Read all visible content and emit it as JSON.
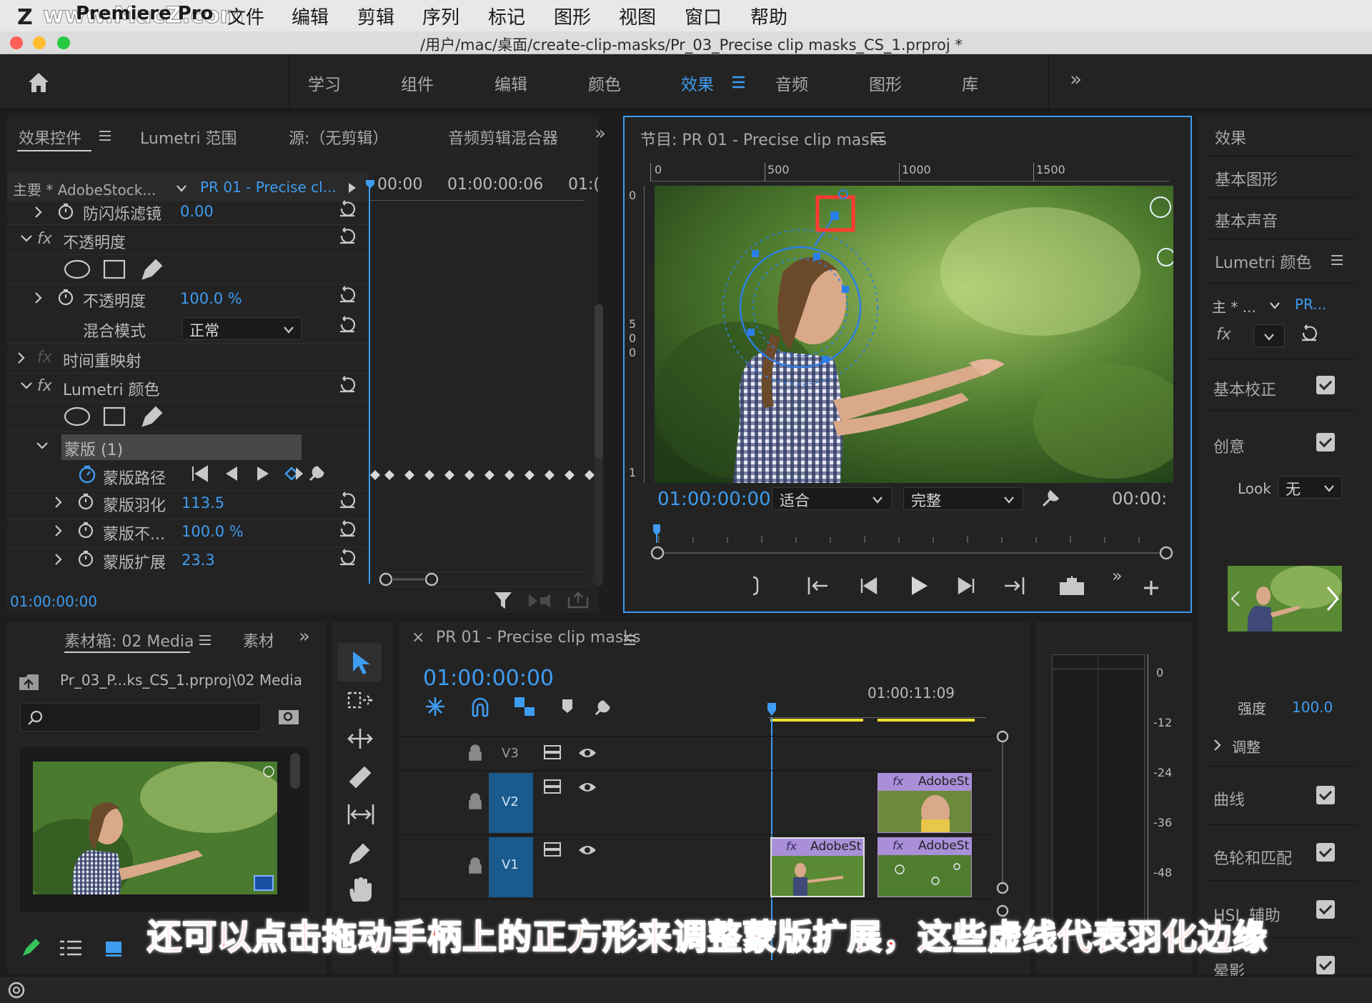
{
  "watermark": "www.MacZ.com",
  "menubar": {
    "app": "Premiere Pro",
    "items": [
      "文件",
      "编辑",
      "剪辑",
      "序列",
      "标记",
      "图形",
      "视图",
      "窗口",
      "帮助"
    ]
  },
  "window_title": "/用户/mac/桌面/create-clip-masks/Pr_03_Precise clip masks_CS_1.prproj *",
  "workspace": {
    "tabs": [
      "学习",
      "组件",
      "编辑",
      "颜色",
      "效果",
      "音频",
      "图形",
      "库"
    ],
    "active": "效果",
    "more": "»"
  },
  "effect_controls": {
    "tabs": [
      "效果控件",
      "Lumetri 范围",
      "源:（无剪辑）",
      "音频剪辑混合器"
    ],
    "more": "»",
    "master_clip": "主要 * AdobeStock...",
    "sequence_clip": "PR 01 - Precise cl...",
    "timecodes": [
      "00:00",
      "01:00:00:06",
      "01:("
    ],
    "rows": {
      "anti_flicker": {
        "label": "防闪烁滤镜",
        "value": "0.00"
      },
      "opacity_fx": "不透明度",
      "opacity": {
        "label": "不透明度",
        "value": "100.0 %"
      },
      "blend_mode": {
        "label": "混合模式",
        "value": "正常"
      },
      "time_remap": "时间重映射",
      "lumetri": "Lumetri 颜色",
      "mask": "蒙版 (1)",
      "mask_path": "蒙版路径",
      "mask_feather": {
        "label": "蒙版羽化",
        "value": "113.5"
      },
      "mask_opacity": {
        "label": "蒙版不...",
        "value": "100.0 %"
      },
      "mask_expansion": {
        "label": "蒙版扩展",
        "value": "23.3"
      }
    },
    "fx_label": "fx",
    "current_time": "01:00:00:00"
  },
  "program": {
    "title": "节目: PR 01 - Precise clip masks",
    "ruler": [
      "0",
      "500",
      "1000",
      "1500"
    ],
    "vruler": [
      "0",
      "5",
      "0",
      "0",
      "1"
    ],
    "timecode": "01:00:00:00",
    "fit": "适合",
    "quality": "完整",
    "duration": "00:00:",
    "more": "»"
  },
  "right_panel": {
    "items": [
      "效果",
      "基本图形",
      "基本声音",
      "Lumetri 颜色"
    ],
    "master": "主 * ...",
    "seq": "PR...",
    "sections": [
      {
        "label": "基本校正",
        "checked": true
      },
      {
        "label": "创意",
        "checked": true
      }
    ],
    "look_label": "Look",
    "look_value": "无",
    "intensity_label": "强度",
    "intensity_value": "100.0",
    "adjust": "调整",
    "sections2": [
      {
        "label": "曲线",
        "checked": true
      },
      {
        "label": "色轮和匹配",
        "checked": true
      },
      {
        "label": "HSL 辅助",
        "checked": true
      },
      {
        "label": "晕影",
        "checked": true
      }
    ]
  },
  "project": {
    "tabs": [
      "素材箱: 02 Media",
      "素材"
    ],
    "more": "»",
    "path": "Pr_03_P...ks_CS_1.prproj\\02 Media",
    "search_placeholder": ""
  },
  "timeline": {
    "title": "PR 01 - Precise clip masks",
    "close": "×",
    "timecode": "01:00:00:00",
    "ruler_time": "01:00:11:09",
    "tracks": [
      "V3",
      "V2",
      "V1"
    ],
    "clips": [
      {
        "label": "AdobeSt",
        "track": "V2"
      },
      {
        "label": "AdobeSt",
        "track": "V1"
      },
      {
        "label": "AdobeSt",
        "track": "V1"
      }
    ]
  },
  "audio_meter": {
    "scale": [
      "0",
      "-12",
      "-24",
      "-36",
      "-48"
    ]
  },
  "subtitle": "还可以点击拖动手柄上的正方形来调整蒙版扩展，这些虚线代表羽化边缘",
  "colors": {
    "accent": "#3e9cf0",
    "panel": "#232323",
    "highlight_red": "#ff3b2f",
    "clip_purple": "#a98fd8"
  }
}
